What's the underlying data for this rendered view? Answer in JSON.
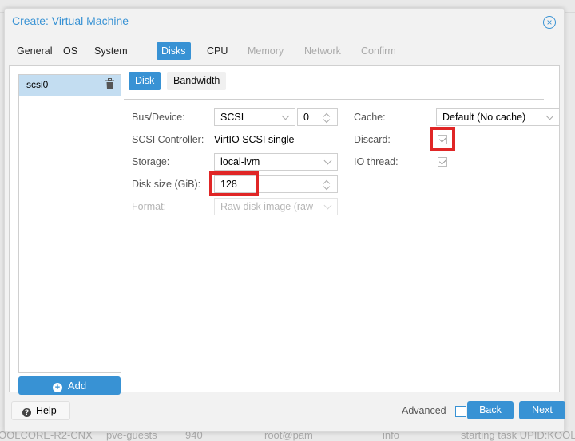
{
  "dialog": {
    "title": "Create: Virtual Machine",
    "close_icon": "close-circle-icon"
  },
  "wizard_tabs": [
    {
      "label": "General",
      "state": "enabled"
    },
    {
      "label": "OS",
      "state": "enabled"
    },
    {
      "label": "System",
      "state": "enabled"
    },
    {
      "label": "Disks",
      "state": "active"
    },
    {
      "label": "CPU",
      "state": "enabled"
    },
    {
      "label": "Memory",
      "state": "disabled"
    },
    {
      "label": "Network",
      "state": "disabled"
    },
    {
      "label": "Confirm",
      "state": "disabled"
    }
  ],
  "disk_list": {
    "items": [
      {
        "name": "scsi0",
        "selected": true,
        "delete_icon": "trash-icon"
      }
    ],
    "add_label": "Add",
    "add_icon": "plus-circle-icon"
  },
  "subtabs": [
    {
      "label": "Disk",
      "active": true
    },
    {
      "label": "Bandwidth",
      "active": false
    }
  ],
  "form": {
    "bus_device": {
      "label": "Bus/Device:",
      "bus": "SCSI",
      "device": "0"
    },
    "scsi_controller": {
      "label": "SCSI Controller:",
      "value": "VirtIO SCSI single"
    },
    "storage": {
      "label": "Storage:",
      "value": "local-lvm"
    },
    "disk_size": {
      "label": "Disk size (GiB):",
      "value": "128"
    },
    "format": {
      "label": "Format:",
      "value": "Raw disk image (raw",
      "disabled": true
    },
    "cache": {
      "label": "Cache:",
      "value": "Default (No cache)"
    },
    "discard": {
      "label": "Discard:",
      "checked": true
    },
    "io_thread": {
      "label": "IO thread:",
      "checked": true
    }
  },
  "highlight_color": "#e02626",
  "accent_color": "#3892d4",
  "footer": {
    "help_label": "Help",
    "help_icon": "question-circle-icon",
    "advanced_label": "Advanced",
    "advanced_checked": false,
    "back_label": "Back",
    "next_label": "Next"
  },
  "background_log": [
    "OOLCORE-R2-CNX",
    "pve-guests",
    "940",
    "root@pam",
    "info",
    "starting task UPID:KOOL"
  ]
}
